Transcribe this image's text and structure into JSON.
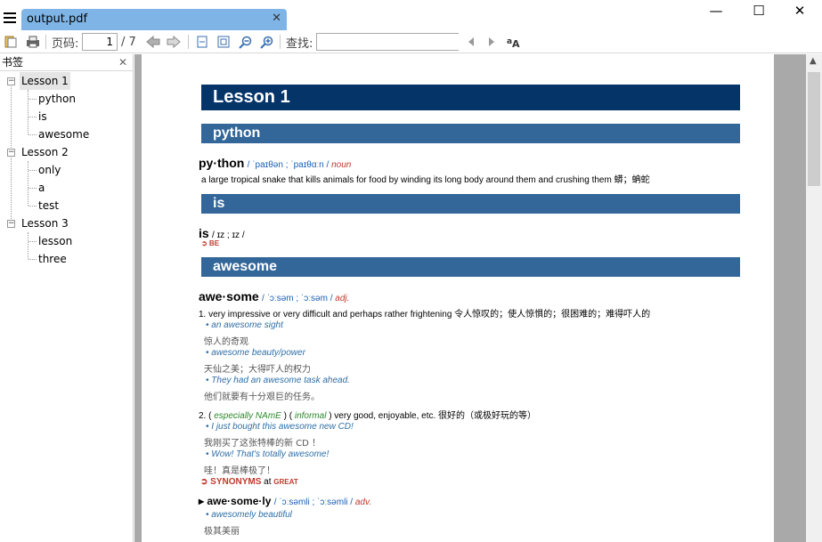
{
  "window": {
    "tab_title": "output.pdf",
    "tab_close": "✕",
    "min": "—",
    "max": "☐",
    "close": "✕"
  },
  "toolbar": {
    "page_label": "页码:",
    "page_current": "1",
    "page_total": "/ 7",
    "search_label": "查找:",
    "search_value": ""
  },
  "sidebar": {
    "title": "书签",
    "close": "✕",
    "tree": [
      {
        "label": "Lesson 1",
        "toggle": "−",
        "children": [
          "python",
          "is",
          "awesome"
        ]
      },
      {
        "label": "Lesson 2",
        "toggle": "−",
        "children": [
          "only",
          "a",
          "test"
        ]
      },
      {
        "label": "Lesson 3",
        "toggle": "−",
        "children": [
          "lesson",
          "three"
        ]
      }
    ]
  },
  "doc": {
    "lesson_title": "Lesson 1",
    "sec_python": "python",
    "python_word": "py·thon",
    "python_pron": "/ ˈpaɪθən ; ˈpaɪθɑːn /",
    "python_pos": "noun",
    "python_def": "a large tropical snake that kills animals for food by winding its long body around them and crushing them 蟒；蚺蛇",
    "sec_is": "is",
    "is_word": "is",
    "is_pron": "/ ɪz ; ɪz /",
    "is_ref": "➲ BE",
    "sec_awesome": "awesome",
    "awe_word": "awe·some",
    "awe_pron": "/ ˈɔːsəm ; ˈɔːsəm /",
    "awe_pos": "adj.",
    "awe_def1": "1. very impressive or very difficult and perhaps rather frightening 令人惊叹的；使人惊惧的；很困难的；难得吓人的",
    "ex1": "• an awesome sight",
    "tr1": "惊人的奇观",
    "ex2": "• awesome beauty/power",
    "tr2": "天仙之美；大得吓人的权力",
    "ex3": "• They had an awesome task ahead.",
    "tr3": "他们就要有十分艰巨的任务。",
    "awe_def2_pre": "2. (",
    "awe_def2_g1": "especially NAmE",
    "awe_def2_mid": ") (",
    "awe_def2_g2": "informal",
    "awe_def2_post": ") very good, enjoyable, etc. 很好的（或极好玩的等）",
    "ex4": "• I just bought this awesome new CD!",
    "tr4": "我刚买了这张特棒的新 CD ！",
    "ex5": "• Wow! That's totally awesome!",
    "tr5": "哇！真是棒极了！",
    "syn_label": "➲ SYNONYMS",
    "syn_at": "at",
    "syn_word": "GREAT",
    "awely_word": "▸ awe·some·ly",
    "awely_pron": "/ ˈɔːsəmli ; ˈɔːsəmli /",
    "awely_pos": "adv.",
    "ex6": "• awesomely beautiful",
    "tr6": "极其美丽"
  },
  "colors": {
    "band_dark": "#053469",
    "band_mid": "#336699",
    "tab": "#7fb5e6"
  }
}
